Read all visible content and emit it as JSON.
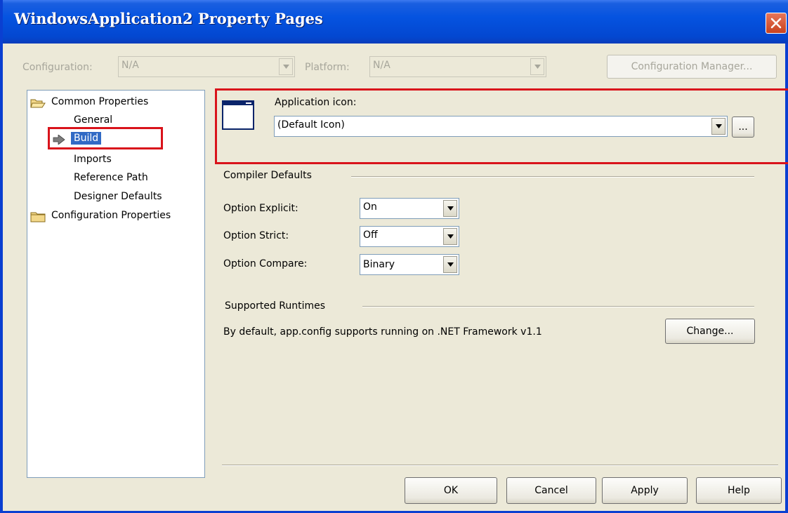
{
  "window": {
    "title": "WindowsApplication2 Property Pages"
  },
  "config_bar": {
    "configuration_label": "Configuration:",
    "configuration_value": "N/A",
    "platform_label": "Platform:",
    "platform_value": "N/A",
    "config_manager_label": "Configuration Manager..."
  },
  "tree": {
    "items": [
      {
        "label": "Common Properties",
        "icon": "open-folder-icon"
      },
      {
        "label": "General"
      },
      {
        "label": "Build",
        "selected": true,
        "icon": "arrow-right-icon"
      },
      {
        "label": "Imports"
      },
      {
        "label": "Reference Path"
      },
      {
        "label": "Designer Defaults"
      },
      {
        "label": "Configuration Properties",
        "icon": "closed-folder-icon"
      }
    ]
  },
  "app_icon": {
    "label": "Application icon:",
    "value": "(Default Icon)",
    "browse_label": "..."
  },
  "compiler_defaults": {
    "heading": "Compiler Defaults",
    "option_explicit_label": "Option Explicit:",
    "option_explicit_value": "On",
    "option_strict_label": "Option Strict:",
    "option_strict_value": "Off",
    "option_compare_label": "Option Compare:",
    "option_compare_value": "Binary"
  },
  "supported_runtimes": {
    "heading": "Supported Runtimes",
    "description": "By default, app.config supports running on .NET Framework v1.1",
    "change_label": "Change..."
  },
  "buttons": {
    "ok": "OK",
    "cancel": "Cancel",
    "apply": "Apply",
    "help": "Help"
  },
  "colors": {
    "title_bar": "#0553e0",
    "highlight_box": "#d9131b",
    "dialog_bg": "#ece9d8",
    "selection": "#316ac5"
  }
}
